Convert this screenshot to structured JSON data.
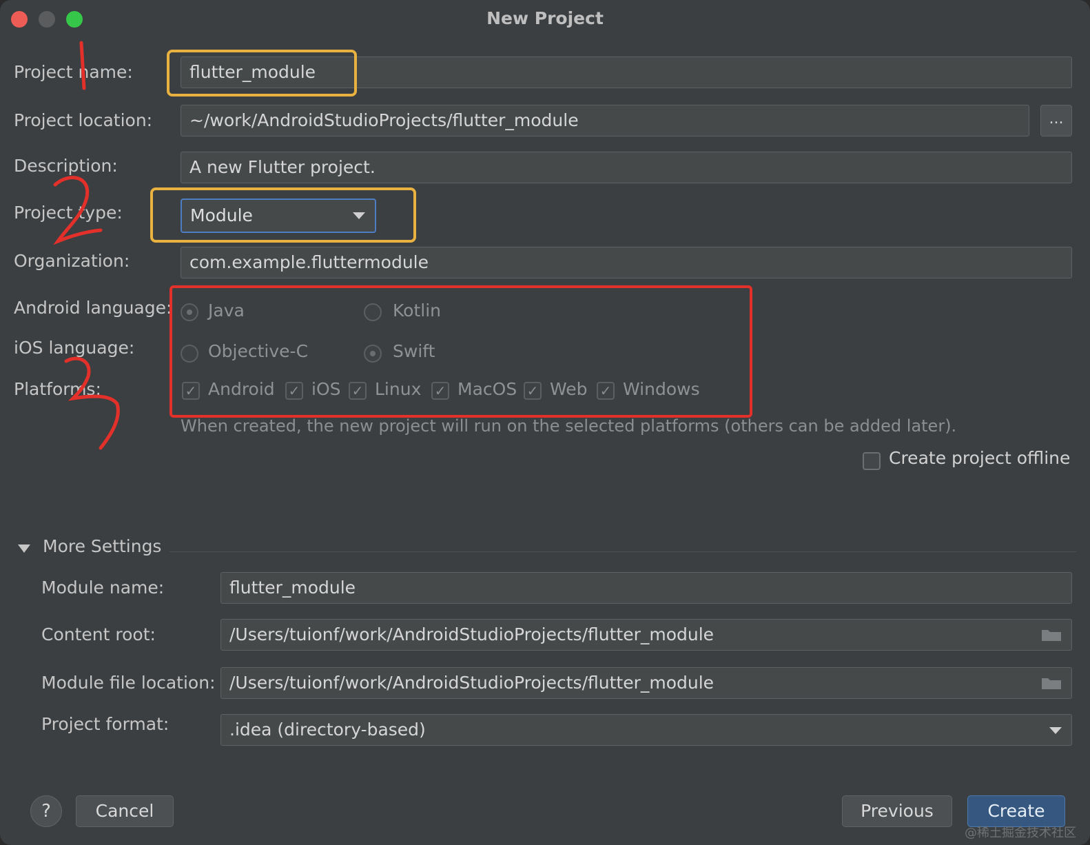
{
  "window": {
    "title": "New Project"
  },
  "form": {
    "project_name_label": "Project name:",
    "project_name_value": "flutter_module",
    "project_location_label": "Project location:",
    "project_location_value": "~/work/AndroidStudioProjects/flutter_module",
    "browse_label": "...",
    "description_label": "Description:",
    "description_value": "A new Flutter project.",
    "project_type_label": "Project type:",
    "project_type_value": "Module",
    "organization_label": "Organization:",
    "organization_value": "com.example.fluttermodule",
    "android_language_label": "Android language:",
    "android_language_options": [
      "Java",
      "Kotlin"
    ],
    "android_language_selected": "Java",
    "ios_language_label": "iOS language:",
    "ios_language_options": [
      "Objective-C",
      "Swift"
    ],
    "ios_language_selected": "Swift",
    "platforms_label": "Platforms:",
    "platforms": [
      {
        "label": "Android",
        "checked": true
      },
      {
        "label": "iOS",
        "checked": true
      },
      {
        "label": "Linux",
        "checked": true
      },
      {
        "label": "MacOS",
        "checked": true
      },
      {
        "label": "Web",
        "checked": true
      },
      {
        "label": "Windows",
        "checked": true
      }
    ],
    "platforms_hint": "When created, the new project will run on the selected platforms (others can be added later).",
    "offline_label": "Create project offline",
    "offline_checked": false
  },
  "more_settings": {
    "title": "More Settings",
    "module_name_label": "Module name:",
    "module_name_value": "flutter_module",
    "content_root_label": "Content root:",
    "content_root_value": "/Users/tuionf/work/AndroidStudioProjects/flutter_module",
    "module_file_location_label": "Module file location:",
    "module_file_location_value": "/Users/tuionf/work/AndroidStudioProjects/flutter_module",
    "project_format_label": "Project format:",
    "project_format_value": ".idea (directory-based)"
  },
  "footer": {
    "help_label": "?",
    "cancel_label": "Cancel",
    "previous_label": "Previous",
    "create_label": "Create"
  },
  "watermark": "@稀土掘金技术社区",
  "colors": {
    "background": "#3c3f41",
    "field": "#45494a",
    "accent_blue": "#4b7ec3",
    "highlight_yellow": "#e9b13f",
    "highlight_red": "#e3302a",
    "create_button": "#365880"
  }
}
